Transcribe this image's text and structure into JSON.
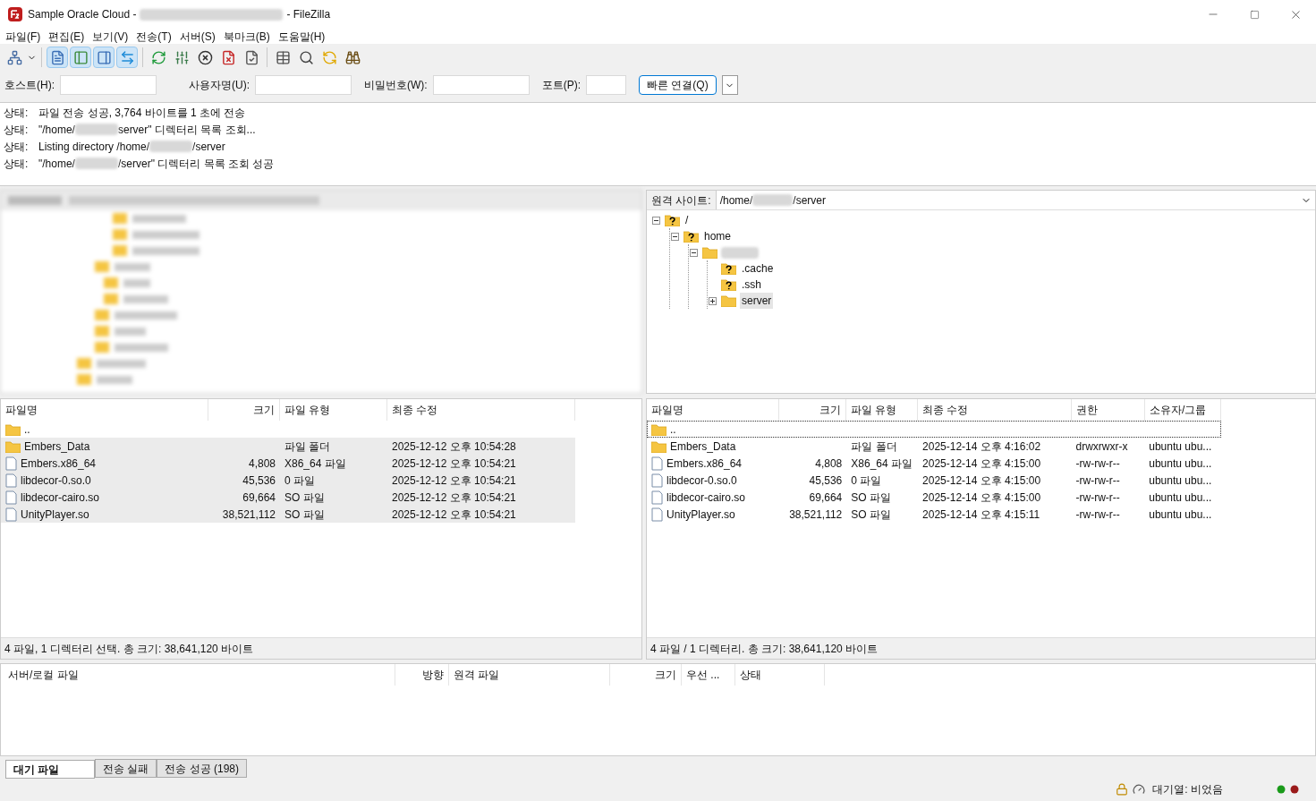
{
  "window": {
    "title_before": "Sample Oracle Cloud -",
    "title_after": "- FileZilla"
  },
  "menu": [
    "파일(F)",
    "편집(E)",
    "보기(V)",
    "전송(T)",
    "서버(S)",
    "북마크(B)",
    "도움말(H)"
  ],
  "toolbar": [
    {
      "kind": "site-manager",
      "pressed": false
    },
    {
      "kind": "log",
      "pressed": true
    },
    {
      "kind": "local-tree",
      "pressed": true
    },
    {
      "kind": "remote-tree",
      "pressed": true
    },
    {
      "kind": "queue",
      "pressed": true
    },
    {
      "kind": "refresh",
      "pressed": false
    },
    {
      "kind": "filter",
      "pressed": false
    },
    {
      "kind": "cancel",
      "pressed": false
    },
    {
      "kind": "disconnect",
      "pressed": false
    },
    {
      "kind": "reconnect",
      "pressed": false
    },
    {
      "kind": "compare",
      "pressed": false
    },
    {
      "kind": "search",
      "pressed": false
    },
    {
      "kind": "sync",
      "pressed": false
    },
    {
      "kind": "find",
      "pressed": false
    }
  ],
  "quickconnect": {
    "host_label": "호스트(H):",
    "user_label": "사용자명(U):",
    "pass_label": "비밀번호(W):",
    "port_label": "포트(P):",
    "button": "빠른 연결(Q)"
  },
  "log": [
    {
      "tag": "상태:",
      "parts": [
        "파일 전송 성공, 3,764 바이트를 1 초에 전송"
      ]
    },
    {
      "tag": "상태:",
      "parts": [
        "\"/home/",
        "server\" 디렉터리 목록 조회..."
      ]
    },
    {
      "tag": "상태:",
      "parts": [
        "Listing directory /home/",
        "/server"
      ]
    },
    {
      "tag": "상태:",
      "parts": [
        "\"/home/",
        "/server\" 디렉터리 목록 조회 성공"
      ]
    }
  ],
  "remote_site": {
    "label": "원격 사이트:",
    "path_parts": [
      "/home/",
      "/server"
    ]
  },
  "remote_tree": [
    {
      "label": "/",
      "kind": "unknown",
      "expanded": true,
      "selected": false,
      "children": [
        {
          "label": "home",
          "kind": "unknown",
          "expanded": true,
          "selected": false,
          "children": [
            {
              "kind": "folder",
              "expanded": true,
              "selected": false,
              "children": [
                {
                  "label": ".cache",
                  "kind": "unknown",
                  "selected": false
                },
                {
                  "label": ".ssh",
                  "kind": "unknown",
                  "selected": false
                },
                {
                  "label": "server",
                  "kind": "folder",
                  "expanded": false,
                  "selected": true
                }
              ]
            }
          ]
        }
      ]
    }
  ],
  "local_files": {
    "columns": [
      "파일명",
      "크기",
      "파일 유형",
      "최종 수정"
    ],
    "rows": [
      {
        "kind": "folder",
        "name": "..",
        "selected": false
      },
      {
        "kind": "folder",
        "name": "Embers_Data",
        "type": "파일 폴더",
        "modified": "2025-12-12 오후 10:54:28",
        "selected": true
      },
      {
        "kind": "file",
        "name": "Embers.x86_64",
        "size": "4,808",
        "type": "X86_64 파일",
        "modified": "2025-12-12 오후 10:54:21",
        "selected": true
      },
      {
        "kind": "file",
        "name": "libdecor-0.so.0",
        "size": "45,536",
        "type": "0 파일",
        "modified": "2025-12-12 오후 10:54:21",
        "selected": true
      },
      {
        "kind": "file",
        "name": "libdecor-cairo.so",
        "size": "69,664",
        "type": "SO 파일",
        "modified": "2025-12-12 오후 10:54:21",
        "selected": true
      },
      {
        "kind": "file",
        "name": "UnityPlayer.so",
        "size": "38,521,112",
        "type": "SO 파일",
        "modified": "2025-12-12 오후 10:54:21",
        "selected": true
      }
    ],
    "status": "4 파일, 1 디렉터리 선택. 총 크기: 38,641,120 바이트"
  },
  "remote_files": {
    "columns": [
      "파일명",
      "크기",
      "파일 유형",
      "최종 수정",
      "권한",
      "소유자/그룹"
    ],
    "rows": [
      {
        "kind": "folder",
        "name": "..",
        "focused": true
      },
      {
        "kind": "folder",
        "name": "Embers_Data",
        "type": "파일 폴더",
        "modified": "2025-12-14 오후 4:16:02",
        "perm": "drwxrwxr-x",
        "owner": "ubuntu ubu...",
        "focused": false
      },
      {
        "kind": "file",
        "name": "Embers.x86_64",
        "size": "4,808",
        "type": "X86_64 파일",
        "modified": "2025-12-14 오후 4:15:00",
        "perm": "-rw-rw-r--",
        "owner": "ubuntu ubu...",
        "focused": false
      },
      {
        "kind": "file",
        "name": "libdecor-0.so.0",
        "size": "45,536",
        "type": "0 파일",
        "modified": "2025-12-14 오후 4:15:00",
        "perm": "-rw-rw-r--",
        "owner": "ubuntu ubu...",
        "focused": false
      },
      {
        "kind": "file",
        "name": "libdecor-cairo.so",
        "size": "69,664",
        "type": "SO 파일",
        "modified": "2025-12-14 오후 4:15:00",
        "perm": "-rw-rw-r--",
        "owner": "ubuntu ubu...",
        "focused": false
      },
      {
        "kind": "file",
        "name": "UnityPlayer.so",
        "size": "38,521,112",
        "type": "SO 파일",
        "modified": "2025-12-14 오후 4:15:11",
        "perm": "-rw-rw-r--",
        "owner": "ubuntu ubu...",
        "focused": false
      }
    ],
    "status": "4 파일 / 1 디렉터리. 총 크기: 38,641,120 바이트"
  },
  "queue": {
    "columns": [
      "서버/로컬 파일",
      "방향",
      "원격 파일",
      "크기",
      "우선 ...",
      "상태"
    ]
  },
  "queue_tabs": [
    {
      "label": "대기 파일",
      "selected": true
    },
    {
      "label": "전송 실패",
      "selected": false
    },
    {
      "label": "전송 성공 (198)",
      "selected": false
    }
  ],
  "status_bar": {
    "queue": "대기열: 비었음"
  }
}
